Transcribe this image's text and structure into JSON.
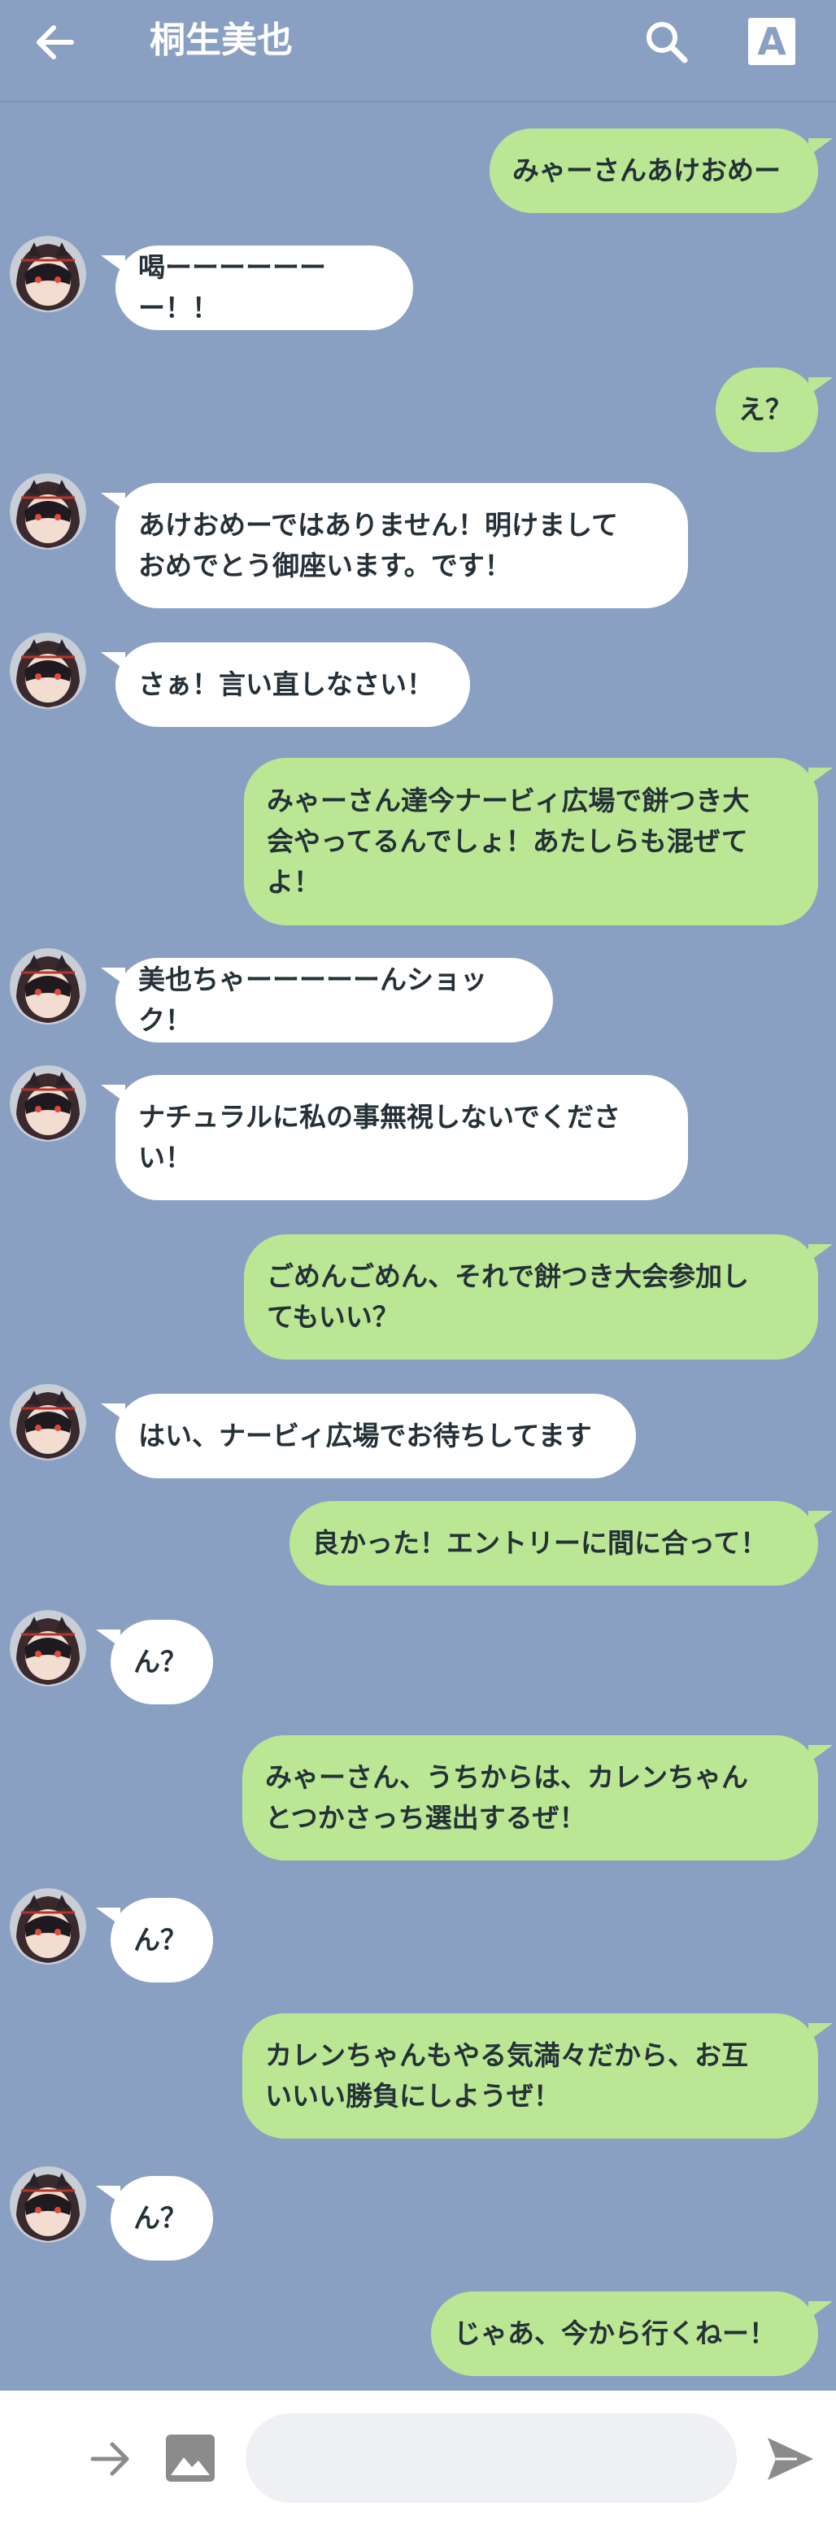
{
  "header": {
    "title": "桐生美也",
    "font_button": "A"
  },
  "colors": {
    "background": "#8aa0c3",
    "incoming": "#ffffff",
    "outgoing": "#bbe795",
    "text": "#253137"
  },
  "icons": {
    "back": "arrow-left-icon",
    "search": "search-icon",
    "font": "font-size-icon",
    "forward": "arrow-right-icon",
    "image": "image-icon",
    "send": "send-icon"
  },
  "messages": [
    {
      "side": "out",
      "text": "みゃーさんあけおめー"
    },
    {
      "side": "in",
      "text": "喝ーーーーーーー！！"
    },
    {
      "side": "out",
      "text": "え？"
    },
    {
      "side": "in",
      "text": "あけおめーではありません！明けまして\nおめでとう御座います。です！"
    },
    {
      "side": "in",
      "text": "さぁ！言い直しなさい！"
    },
    {
      "side": "out",
      "text": "みゃーさん達今ナービィ広場で餅つき大\n会やってるんでしょ！あたしらも混ぜて\nよ！"
    },
    {
      "side": "in",
      "text": "美也ちゃーーーーーんショック！"
    },
    {
      "side": "in",
      "text": "ナチュラルに私の事無視しないでくださ\nい！"
    },
    {
      "side": "out",
      "text": "ごめんごめん、それで餅つき大会参加し\nてもいい？"
    },
    {
      "side": "in",
      "text": "はい、ナービィ広場でお待ちしてます"
    },
    {
      "side": "out",
      "text": "良かった！エントリーに間に合って！"
    },
    {
      "side": "in",
      "text": "ん？"
    },
    {
      "side": "out",
      "text": "みゃーさん、うちからは、カレンちゃん\nとつかさっち選出するぜ！"
    },
    {
      "side": "in",
      "text": "ん？"
    },
    {
      "side": "out",
      "text": "カレンちゃんもやる気満々だから、お互\nいいい勝負にしようぜ！"
    },
    {
      "side": "in",
      "text": "ん？"
    },
    {
      "side": "out",
      "text": "じゃあ、今から行くねー！"
    }
  ],
  "composer": {
    "placeholder": ""
  }
}
